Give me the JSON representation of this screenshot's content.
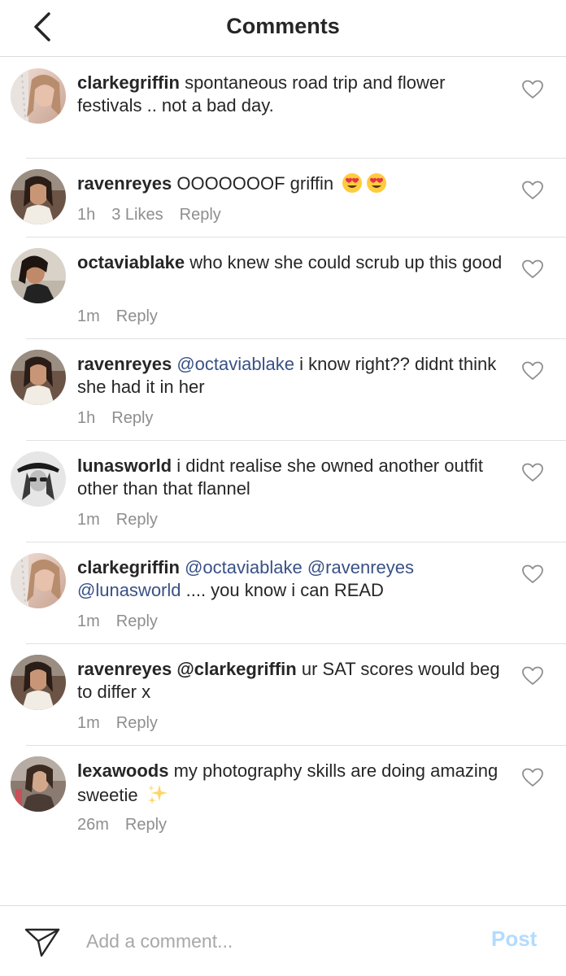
{
  "header": {
    "title": "Comments",
    "back_icon": "chevron-left-icon"
  },
  "comments": [
    {
      "username": "clarkegriffin",
      "text": "spontaneous road trip and flower festivals .. not a bad day.",
      "time": "",
      "likes": "",
      "reply": ""
    },
    {
      "username": "ravenreyes",
      "text": "OOOOOOOF griffin",
      "emojis": [
        "heart-eyes-emoji",
        "heart-eyes-emoji"
      ],
      "time": "1h",
      "likes": "3 Likes",
      "reply": "Reply"
    },
    {
      "username": "octaviablake",
      "text": "who knew she could scrub up this good",
      "time": "1m",
      "reply": "Reply"
    },
    {
      "username": "ravenreyes",
      "mention": "@octaviablake",
      "text": "i know right?? didnt think she had it in her",
      "time": "1h",
      "reply": "Reply"
    },
    {
      "username": "lunasworld",
      "text": "i didnt realise she owned another outfit other than that flannel",
      "time": "1m",
      "reply": "Reply"
    },
    {
      "username": "clarkegriffin",
      "mention1": "@octaviablake",
      "mention2": "@ravenreyes",
      "mention3": "@lunasworld",
      "text": ".... you know i can READ",
      "time": "1m",
      "reply": "Reply"
    },
    {
      "username": "ravenreyes",
      "mention": "@clarkegriffin",
      "text": "ur SAT scores would beg to differ x",
      "time": "1m",
      "reply": "Reply"
    },
    {
      "username": "lexawoods",
      "text": "my photography skills are doing amazing sweetie",
      "emojis": [
        "sparkles-emoji"
      ],
      "time": "26m",
      "reply": "Reply"
    }
  ],
  "footer": {
    "placeholder": "Add a comment...",
    "post_label": "Post",
    "send_icon": "paper-plane-icon"
  },
  "colors": {
    "text": "#262626",
    "muted": "#8e8e8e",
    "mention": "#385185",
    "post_disabled": "#b3dbff",
    "divider": "#e1e1e1"
  }
}
